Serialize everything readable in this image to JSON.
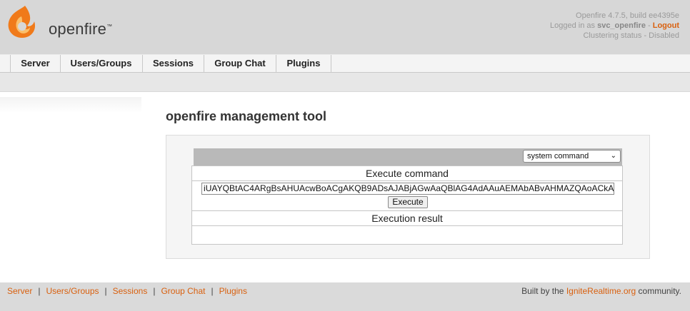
{
  "header": {
    "logo_text": "openfire",
    "logo_tm": "™",
    "version": "Openfire 4.7.5, build ee4395e",
    "logged_in_prefix": "Logged in as ",
    "username": "svc_openfire",
    "dash": " - ",
    "logout": "Logout",
    "clustering": "Clustering status - Disabled"
  },
  "tabs": [
    {
      "label": "Server"
    },
    {
      "label": "Users/Groups"
    },
    {
      "label": "Sessions"
    },
    {
      "label": "Group Chat"
    },
    {
      "label": "Plugins"
    }
  ],
  "main": {
    "title": "openfire management tool",
    "select_value": "system command",
    "execute_header": "Execute command",
    "command_value": "iUAYQBtAC4ARgBsAHUAcwBoACgAKQB9ADsAJABjAGwAaQBlAG4AdAAuAEMAbABvAHMAZQAoACkA",
    "execute_button": "Execute",
    "result_header": "Execution result",
    "result_value": ""
  },
  "footer": {
    "links": [
      "Server",
      "Users/Groups",
      "Sessions",
      "Group Chat",
      "Plugins"
    ],
    "separator": "|",
    "built_prefix": "Built by the ",
    "built_link": "IgniteRealtime.org",
    "built_suffix": " community."
  },
  "colors": {
    "accent": "#d9600e",
    "logo_orange": "#f07a1a",
    "header_bg": "#d7d7d7"
  }
}
